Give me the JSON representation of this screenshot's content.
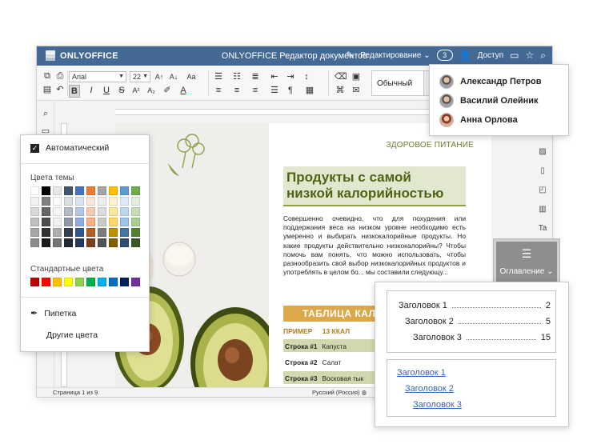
{
  "app": {
    "logo": "ONLYOFFICE",
    "title": "ONLYOFFICE Редактор документов",
    "mode": "Редактирование",
    "users_count": "3",
    "access": "Доступ"
  },
  "toolbar": {
    "font_name": "Arial",
    "font_size": "22",
    "style_name": "Обычный"
  },
  "users": [
    {
      "name": "Александр Петров"
    },
    {
      "name": "Василий Олейник"
    },
    {
      "name": "Анна Орлова"
    }
  ],
  "color_picker": {
    "auto_label": "Автоматический",
    "theme_label": "Цвета темы",
    "standard_label": "Стандартные цвета",
    "eyedropper_label": "Пипетка",
    "more_label": "Другие цвета",
    "theme_top": [
      "#ffffff",
      "#000000",
      "#e7e6e6",
      "#44546a",
      "#4472c4",
      "#ed7d31",
      "#a5a5a5",
      "#ffc000",
      "#5b9bd5",
      "#70ad47"
    ],
    "standard": [
      "#c00000",
      "#ff0000",
      "#ffc000",
      "#ffff00",
      "#92d050",
      "#00b050",
      "#00b0f0",
      "#0070c0",
      "#002060",
      "#7030a0"
    ]
  },
  "document": {
    "kicker": "ЗДОРОВОЕ ПИТАНИЕ",
    "headline_1": "Продукты с самой",
    "headline_2": "низкой калорийностью",
    "body": "Совершенно очевидно, что для похудения или поддержания веса на низком уровне необходимо есть умеренно и выбирать низкокалорийные продукты. Но какие продукты действительно низкокалорийны? Чтобы помочь вам понять, что можно использовать, чтобы разнообразить свой выбор низкокалорийных продуктов и употреблять в целом бо... мы составили следующу...",
    "table_title": "ТАБЛИЦА КАЛ",
    "example_1": "ПРИМЕР",
    "example_2": "13 ККАЛ",
    "rows": [
      {
        "label": "Строка #1",
        "value": "Капуста"
      },
      {
        "label": "Строка #2",
        "value": "Салат"
      },
      {
        "label": "Строка #3",
        "value": "Восковая тык"
      }
    ]
  },
  "status": {
    "page": "Страница 1 из 9",
    "language": "Русский (Россия)"
  },
  "toc_button": {
    "label": "Оглавление"
  },
  "toc": {
    "plain": [
      {
        "text": "Заголовок 1",
        "page": "2"
      },
      {
        "text": "Заголовок 2",
        "page": "5"
      },
      {
        "text": "Заголовок 3",
        "page": "15"
      }
    ],
    "links": [
      {
        "text": "Заголовок 1"
      },
      {
        "text": "Заголовок 2"
      },
      {
        "text": "Заголовок 3"
      }
    ]
  }
}
